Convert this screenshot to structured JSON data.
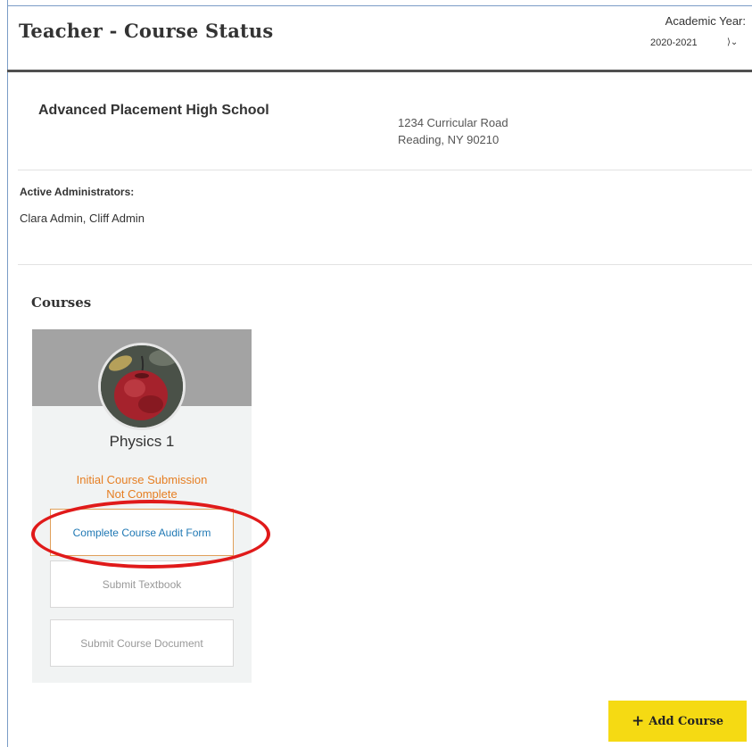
{
  "header": {
    "title": "Teacher - Course Status",
    "academic_year_label": "Academic Year:",
    "academic_year_value": "2020-2021"
  },
  "school": {
    "name": "Advanced Placement High School",
    "address_line1": "1234 Curricular Road",
    "address_line2": "Reading, NY 90210"
  },
  "administrators": {
    "label": "Active Administrators:",
    "names": "Clara Admin, Cliff Admin"
  },
  "courses": {
    "section_title": "Courses",
    "items": [
      {
        "name": "Physics 1",
        "status_line1": "Initial Course Submission",
        "status_line2": "Not Complete",
        "actions": [
          "Complete Course Audit Form",
          "Submit Textbook",
          "Submit Course Document"
        ]
      }
    ]
  },
  "add_course_label": "Add Course",
  "colors": {
    "status_orange": "#e67e22",
    "link_blue": "#1f78b4",
    "add_button_yellow": "#f5da13",
    "highlight_red": "#e01a1a",
    "header_rule": "#505050"
  },
  "icons": {
    "year_select": "chevron-down-icon",
    "add": "plus-icon",
    "course_image": "apple-avatar"
  }
}
